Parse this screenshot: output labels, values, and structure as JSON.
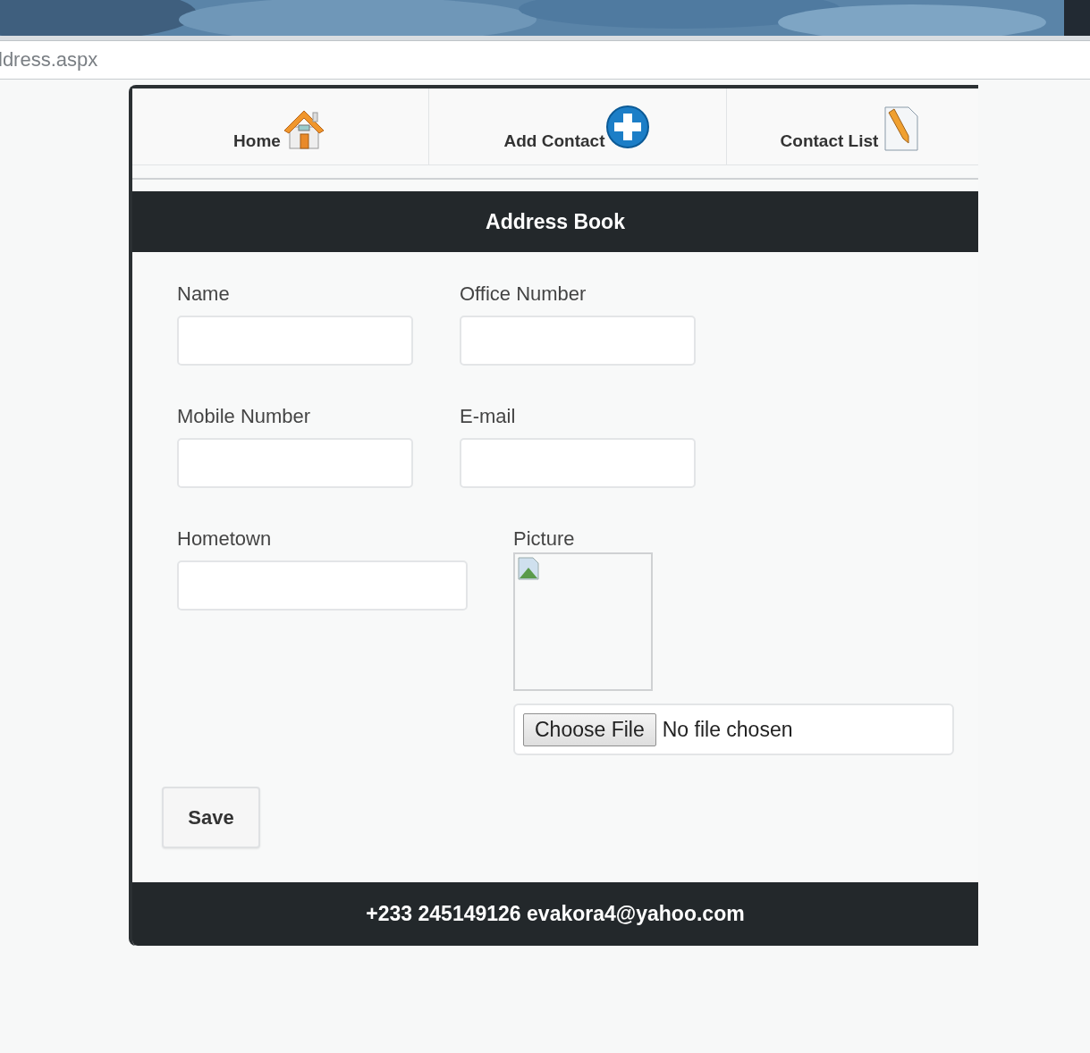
{
  "browser": {
    "address": "ldress.aspx"
  },
  "nav": [
    {
      "label": "Home",
      "kind": "home"
    },
    {
      "label": "Add Contact",
      "kind": "add"
    },
    {
      "label": "Contact List",
      "kind": "list"
    }
  ],
  "header": {
    "title": "Address Book"
  },
  "fields": [
    {
      "label": "Name"
    },
    {
      "label": "Office Number"
    },
    {
      "label": "Mobile Number"
    },
    {
      "label": "E-mail"
    },
    {
      "label": "Hometown"
    }
  ],
  "picture": {
    "label": "Picture",
    "button": "Choose File",
    "status": "No file chosen"
  },
  "save": "Save",
  "footer": "+233 245149126 evakora4@yahoo.com"
}
